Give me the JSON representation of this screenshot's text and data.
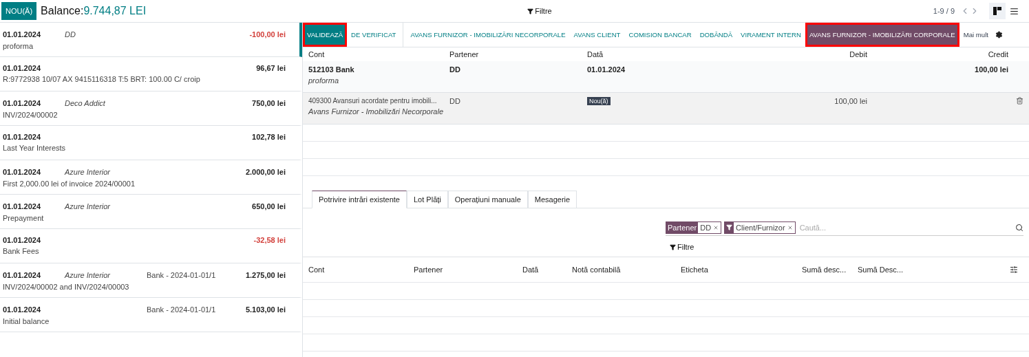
{
  "header": {
    "new_button": "NOU(Ă)",
    "balance_label": "Balance:",
    "balance_value": "9.744,87 LEI",
    "filter": "Filtre",
    "pager": "1-9 / 9",
    "views": [
      {
        "kind": "kanban",
        "selected": true
      },
      {
        "kind": "list",
        "selected": false
      }
    ]
  },
  "transactions": [
    {
      "date": "01.01.2024",
      "partner": "DD",
      "amount": "-100,00 lei",
      "negative": true,
      "label": "proforma",
      "selected": true
    },
    {
      "date": "01.01.2024",
      "amount": "96,67 lei",
      "negative": false,
      "label": "R:9772938 10/07 AX 9415116318 T:5 BRT: 100.00 C/ croip",
      "selected": false
    },
    {
      "date": "01.01.2024",
      "partner": "Deco Addict",
      "amount": "750,00 lei",
      "negative": false,
      "label": "INV/2024/00002",
      "selected": false
    },
    {
      "date": "01.01.2024",
      "amount": "102,78 lei",
      "negative": false,
      "label": "Last Year Interests",
      "selected": false
    },
    {
      "date": "01.01.2024",
      "partner": "Azure Interior",
      "amount": "2.000,00 lei",
      "negative": false,
      "label": "First 2,000.00 lei of invoice 2024/00001",
      "selected": false
    },
    {
      "date": "01.01.2024",
      "partner": "Azure Interior",
      "amount": "650,00 lei",
      "negative": false,
      "label": "Prepayment",
      "selected": false
    },
    {
      "date": "01.01.2024",
      "amount": "-32,58 lei",
      "negative": true,
      "label": "Bank Fees",
      "selected": false
    },
    {
      "date": "01.01.2024",
      "partner": "Azure Interior",
      "reference": "Bank - 2024-01-01/1",
      "amount": "1.275,00 lei",
      "negative": false,
      "label": "INV/2024/00002 and INV/2024/00003",
      "selected": false
    },
    {
      "date": "01.01.2024",
      "reference": "Bank - 2024-01-01/1",
      "amount": "5.103,00 lei",
      "negative": false,
      "label": "Initial balance",
      "selected": false
    }
  ],
  "actions": [
    {
      "label": "VALIDEAZĂ",
      "kind": "primary",
      "highlighted": true
    },
    {
      "label": "DE VERIFICAT",
      "kind": "link",
      "highlighted": false
    },
    {
      "kind": "separator"
    },
    {
      "label": "AVANS FURNIZOR - IMOBILIZĂRI NECORPORALE",
      "kind": "link",
      "highlighted": false
    },
    {
      "label": "AVANS CLIENT",
      "kind": "link",
      "highlighted": false
    },
    {
      "label": "COMISION BANCAR",
      "kind": "link",
      "highlighted": false
    },
    {
      "label": "DOBÂNDĂ",
      "kind": "link",
      "highlighted": false
    },
    {
      "label": "VIRAMENT INTERN",
      "kind": "link",
      "highlighted": false
    },
    {
      "label": "AVANS FURNIZOR - IMOBILIZĂRI CORPORALE",
      "kind": "secondary",
      "highlighted": true
    },
    {
      "label": "Mai mult",
      "kind": "more",
      "highlighted": false
    }
  ],
  "lines_table": {
    "columns": [
      "Cont",
      "Partener",
      "Dată",
      "Debit",
      "Credit"
    ],
    "rows": [
      {
        "kind": "bank",
        "account": "512103 Bank",
        "account_note": "proforma",
        "partner": "DD",
        "date": "01.01.2024",
        "credit": "100,00 lei"
      },
      {
        "kind": "new",
        "account": "409300 Avansuri acordate pentru imobili...",
        "account_note": "Avans Furnizor - Imobilizări Necorporale",
        "partner": "DD",
        "badge": "Nou(ă)",
        "debit": "100,00 lei"
      }
    ]
  },
  "tabs": [
    {
      "label": "Potrivire intrări existente",
      "selected": true
    },
    {
      "label": "Lot Plăți",
      "selected": false
    },
    {
      "label": "Operațiuni manuale",
      "selected": false
    },
    {
      "label": "Mesagerie",
      "selected": false
    }
  ],
  "search": {
    "facets": [
      {
        "kind": "field",
        "label": "Partener",
        "value": "DD"
      },
      {
        "kind": "filter",
        "value": "Client/Furnizor"
      }
    ],
    "placeholder": "Caută...",
    "filter": "Filtre"
  },
  "match_table": {
    "columns": [
      "Cont",
      "Partener",
      "Dată",
      "Notă contabilă",
      "Eticheta",
      "Sumă desc...",
      "Sumă Desc..."
    ]
  }
}
